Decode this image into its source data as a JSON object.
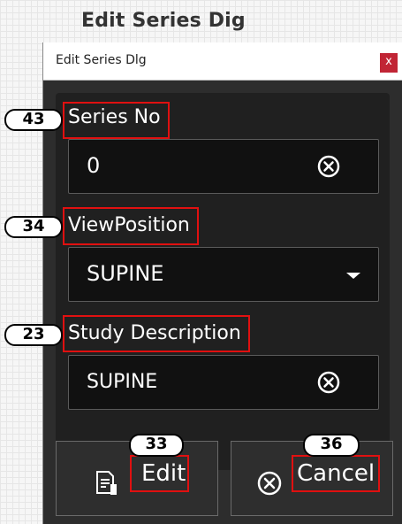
{
  "page": {
    "title": "Edit Series Dig"
  },
  "dialog": {
    "title": "Edit Series Dlg",
    "close_label": "x",
    "series_no": {
      "label": "Series No",
      "value": "0"
    },
    "view_position": {
      "label": "ViewPosition",
      "value": "SUPINE"
    },
    "study_description": {
      "label": "Study Description",
      "value": "SUPINE"
    },
    "edit_button": {
      "label": "Edit",
      "icon": "edit-document-icon"
    },
    "cancel_button": {
      "label": "Cancel",
      "icon": "circle-x-icon"
    }
  },
  "badges": {
    "series_no": "43",
    "view_position": "34",
    "study_description": "23",
    "edit": "33",
    "cancel": "36"
  },
  "colors": {
    "dialog_bg": "#2d2d2d",
    "panel_bg": "#202020",
    "field_bg": "#111111",
    "close_bg": "#c12535",
    "highlight": "#e01010"
  }
}
